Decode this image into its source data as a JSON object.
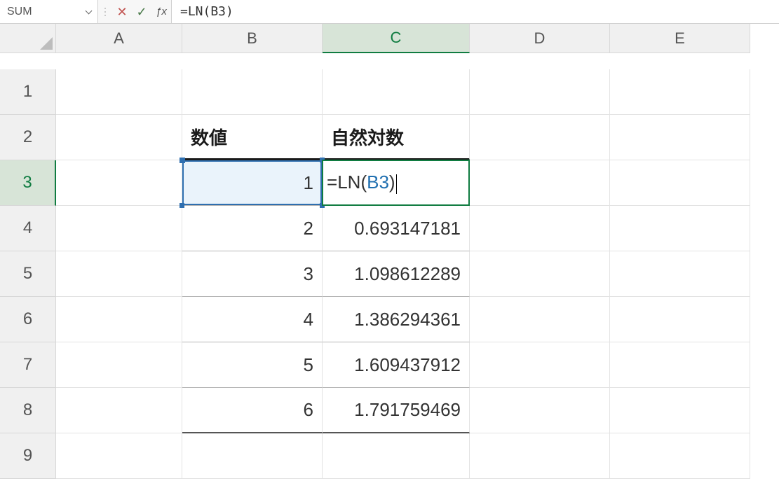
{
  "name_box": "SUM",
  "formula_bar": "=LN(B3)",
  "formula_parts": {
    "eq": "=",
    "fn": "LN",
    "open": "(",
    "ref": "B3",
    "close": ")"
  },
  "columns": [
    "A",
    "B",
    "C",
    "D",
    "E"
  ],
  "row_numbers": [
    "1",
    "2",
    "3",
    "4",
    "5",
    "6",
    "7",
    "8",
    "9"
  ],
  "active_col": "C",
  "active_row": "3",
  "ref_cell_value": "1",
  "headers": {
    "B2": "数値",
    "C2": "自然対数"
  },
  "data": {
    "B": [
      "1",
      "2",
      "3",
      "4",
      "5",
      "6"
    ],
    "C": [
      "=LN(B3)",
      "0.693147181",
      "1.098612289",
      "1.386294361",
      "1.609437912",
      "1.791759469"
    ]
  }
}
